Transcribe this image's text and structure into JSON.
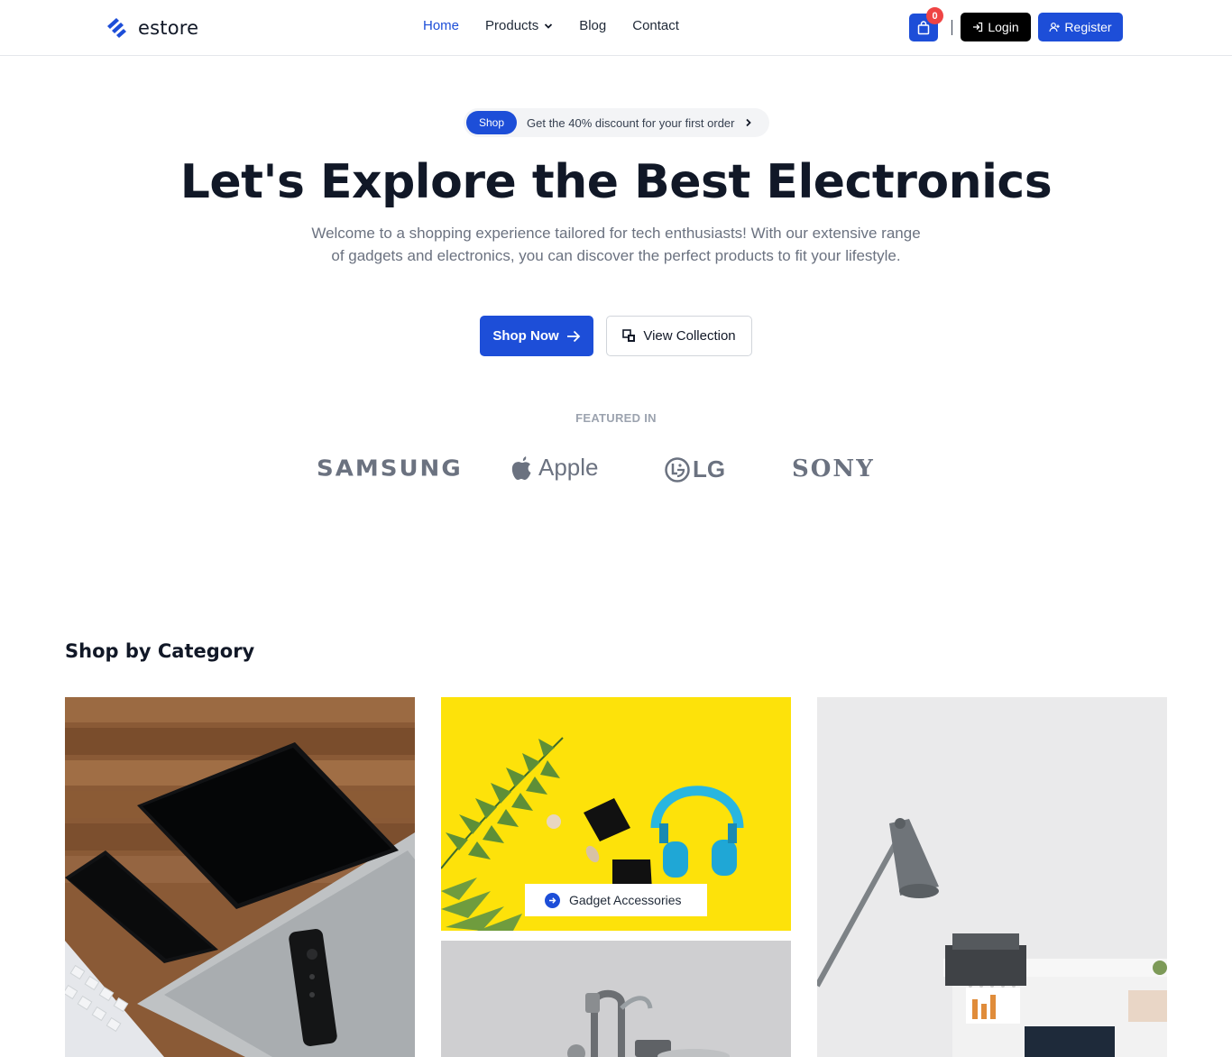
{
  "header": {
    "brand": "estore",
    "nav": [
      {
        "label": "Home"
      },
      {
        "label": "Products"
      },
      {
        "label": "Blog"
      },
      {
        "label": "Contact"
      }
    ],
    "cart_count": "0",
    "separator": "|",
    "login_label": "Login",
    "register_label": "Register"
  },
  "promo": {
    "tag": "Shop",
    "text": "Get the 40% discount for your first order"
  },
  "hero": {
    "title": "Let's Explore the Best Electronics",
    "subtitle": "Welcome to a shopping experience tailored for tech enthusiasts! With our extensive range of gadgets and electronics, you can discover the perfect products to fit your lifestyle.",
    "primary_cta": "Shop Now",
    "secondary_cta": "View Collection"
  },
  "featured": {
    "label": "FEATURED IN",
    "brands": [
      "SAMSUNG",
      "Apple",
      "LG",
      "SONY"
    ]
  },
  "categories": {
    "title": "Shop by Category",
    "items": [
      {
        "label": ""
      },
      {
        "label": "Gadget Accessories"
      },
      {
        "label": ""
      },
      {
        "label": ""
      }
    ]
  },
  "colors": {
    "accent": "#1d4ed8",
    "badge": "#ef4444",
    "dark": "#111827"
  }
}
